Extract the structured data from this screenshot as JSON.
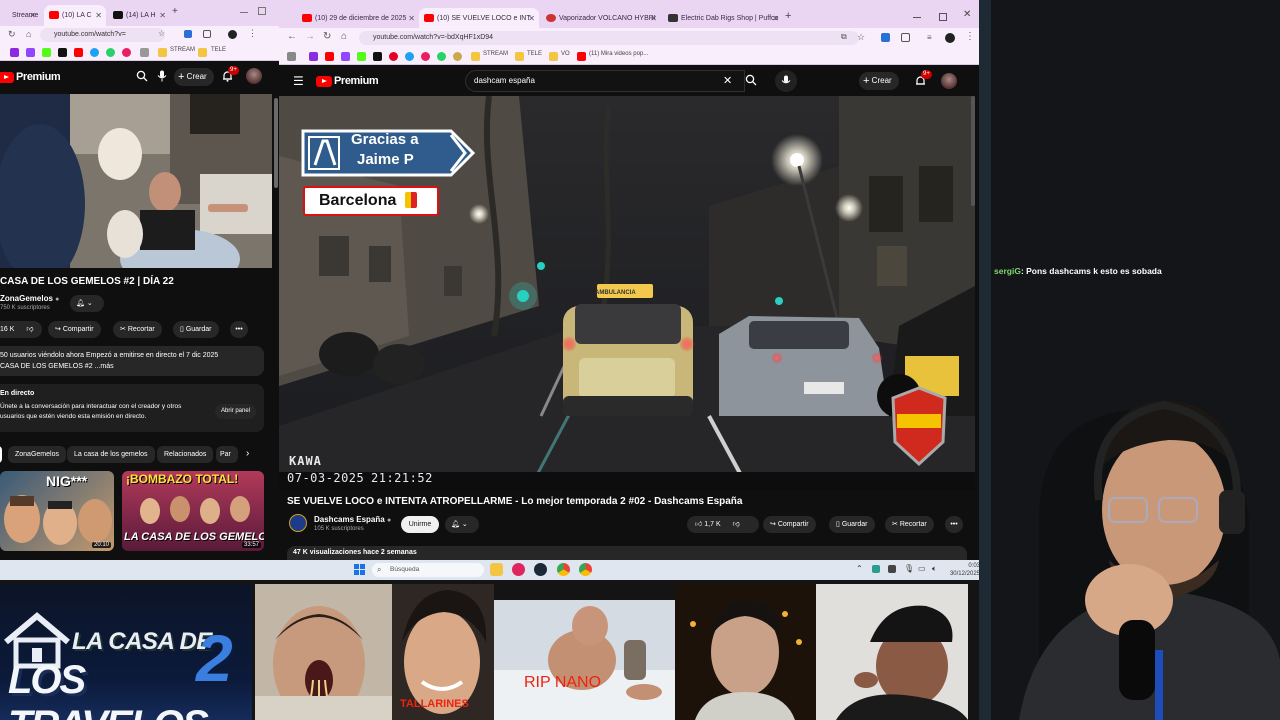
{
  "left_browser": {
    "tabs": [
      {
        "label": "Streame",
        "active": false
      },
      {
        "label": "(10) LA C",
        "active": true
      },
      {
        "label": "(14) LA H",
        "active": false
      }
    ],
    "url": "youtube.com/watch?v=",
    "bookmark_stream": "STREAM",
    "bookmark_tele": "TELE",
    "logo_text": "Premium",
    "crear": "Crear",
    "notif_count": "9+",
    "video_title": "CASA DE LOS GEMELOS #2 | DÍA 22",
    "channel": "ZonaGemelos",
    "subscribers": "750 K suscriptores",
    "likes": "16 K",
    "share": "Compartir",
    "clip": "Recortar",
    "save": "Guardar",
    "desc_line1": "50 usuarios viéndolo ahora  Empezó a emitirse en directo el 7 dic 2025",
    "desc_line2": "CASA DE LOS GEMELOS #2 ...más",
    "chat_title": "En directo",
    "chat_line1": "Únete a la conversación para interactuar con el creador y otros",
    "chat_line2": "usuarios que estén viendo esta emisión en directo.",
    "open_panel": "Abrir panel",
    "chips": [
      "ZonaGemelos",
      "La casa de los gemelos",
      "Relacionados",
      "Par"
    ],
    "thumb1_text": "NIG***",
    "thumb1_duration": "20:10",
    "thumb2_headline": "¡BOMBAZO TOTAL!",
    "thumb2_sub": "LA CASA DE LOS GEMELOS",
    "thumb2_duration": "33:57"
  },
  "right_browser": {
    "tabs": [
      {
        "label": "(10) 29 de diciembre de 2025",
        "active": false
      },
      {
        "label": "(10) SE VUELVE LOCO e INT",
        "active": true
      },
      {
        "label": "Vaporizador VOLCANO HYBRI",
        "active": false
      },
      {
        "label": "Electric Dab Rigs Shop | Puffco",
        "active": false
      }
    ],
    "url": "youtube.com/watch?v=-bdXqHF1xD94",
    "bookmarks": [
      "STREAM",
      "TELE",
      "VO",
      "(11) Mira videos pop..."
    ],
    "logo_text": "Premium",
    "search_query": "dashcam españa",
    "crear": "Crear",
    "notif_count": "9+",
    "overlay_sign_line1": "Gracias a",
    "overlay_sign_line2": "Jaime P",
    "overlay_city": "Barcelona",
    "watermark": "KAWA",
    "date": "07-03-2025",
    "time": "21:21:52",
    "video_title": "SE VUELVE LOCO e INTENTA ATROPELLARME - Lo mejor temporada 2 #02 - Dashcams España",
    "channel": "Dashcams España",
    "subscribers": "105 K suscriptores",
    "join": "Unirme",
    "likes": "1,7 K",
    "share": "Compartir",
    "save": "Guardar",
    "clip": "Recortar",
    "views": "47 K visualizaciones  hace 2 semanas",
    "ambulance_label": "AMBULANCIA"
  },
  "taskbar": {
    "search_placeholder": "Búsqueda",
    "time": "0:03",
    "date": "30/12/2025"
  },
  "chat": {
    "username": "sergiG",
    "message": ": Pons dashcams k esto es sobada"
  },
  "bottom_strip": {
    "logo_line1": "LA CASA DE",
    "logo_line2": "LOS TRAVELOS",
    "logo_number": "2",
    "caption_tallarines": "TALLARINES",
    "caption_rip": "RIP NANO"
  },
  "colors": {
    "yt_red": "#ff0000",
    "chrome_tab_bg": "#ead6f3",
    "chat_username": "#7fd86e"
  }
}
